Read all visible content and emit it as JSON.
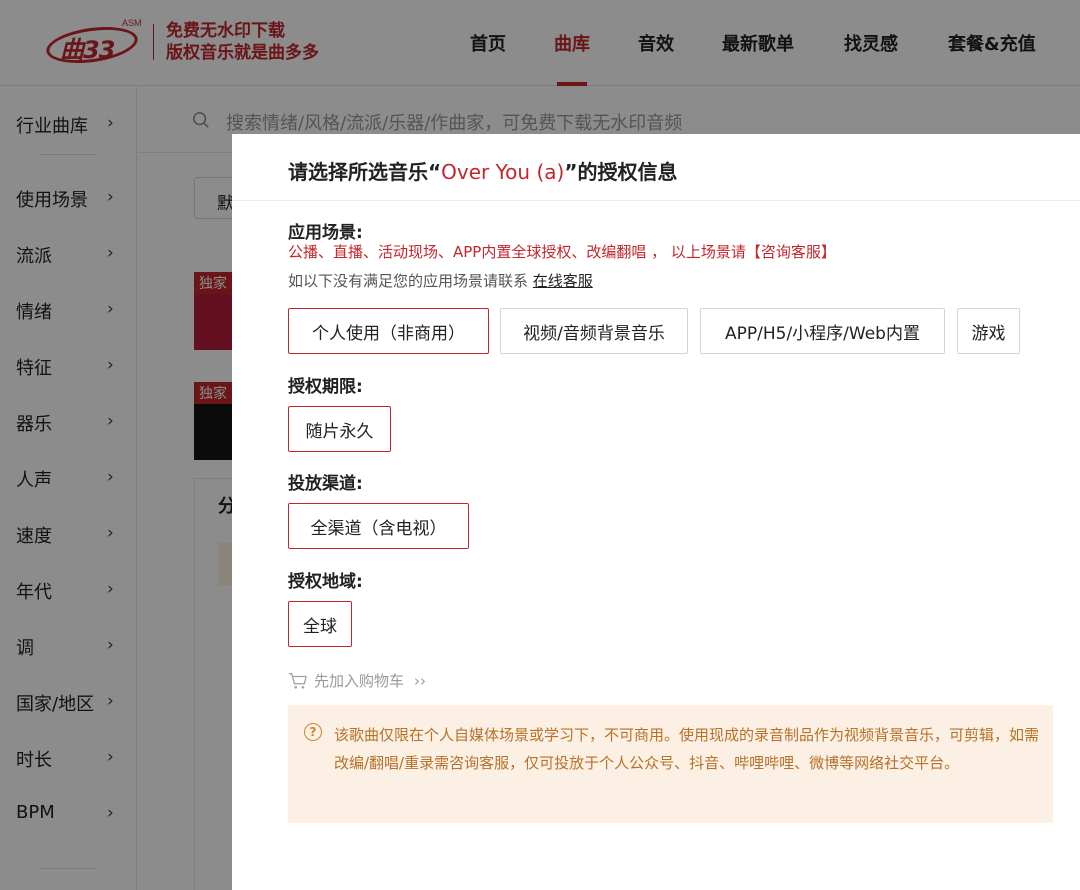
{
  "header": {
    "logo_text": "曲33",
    "logo_sup": "ASM",
    "slogan_line1": "免费无水印下载",
    "slogan_line2": "版权音乐就是曲多多",
    "nav": [
      {
        "label": "首页"
      },
      {
        "label": "曲库"
      },
      {
        "label": "音效"
      },
      {
        "label": "最新歌单"
      },
      {
        "label": "找灵感"
      },
      {
        "label": "套餐&充值"
      }
    ],
    "active_nav": "曲库"
  },
  "sidebar": {
    "items": [
      {
        "label": "行业曲库"
      },
      {
        "label": "使用场景"
      },
      {
        "label": "流派"
      },
      {
        "label": "情绪"
      },
      {
        "label": "特征"
      },
      {
        "label": "器乐"
      },
      {
        "label": "人声"
      },
      {
        "label": "速度"
      },
      {
        "label": "年代"
      },
      {
        "label": "调"
      },
      {
        "label": "国家/地区"
      },
      {
        "label": "时长"
      },
      {
        "label": "BPM"
      }
    ],
    "chevron": "›"
  },
  "search": {
    "placeholder": "搜索情绪/风格/流派/乐器/作曲家，可免费下载无水印音频"
  },
  "background": {
    "sort_button_fragment": "默",
    "tag_exclusive": "独家",
    "panel_tab_fragment": "分"
  },
  "modal": {
    "title_prefix": "请选择所选音乐“",
    "song_name": "Over You (a)",
    "title_suffix": "”的授权信息",
    "scene_label": "应用场景:",
    "scene_note_red": "公播、直播、活动现场、APP内置全球授权、改编翻唱 ， 以上场景请【咨询客服】",
    "scene_note_gray": "如以下没有满足您的应用场景请联系",
    "online_service_link": "在线客服",
    "scene_options": [
      {
        "label": "个人使用（非商用）",
        "selected": true
      },
      {
        "label": "视频/音频背景音乐",
        "selected": false
      },
      {
        "label": "APP/H5/小程序/Web内置",
        "selected": false
      },
      {
        "label": "游戏",
        "selected": false
      }
    ],
    "period_label": "授权期限:",
    "period_options": [
      {
        "label": "随片永久",
        "selected": true
      }
    ],
    "channel_label": "投放渠道:",
    "channel_options": [
      {
        "label": "全渠道（含电视）",
        "selected": true
      }
    ],
    "region_label": "授权地域:",
    "region_options": [
      {
        "label": "全球",
        "selected": true
      }
    ],
    "add_to_cart": "先加入购物车",
    "add_to_cart_arrow": "››",
    "notice_icon": "?",
    "notice_text": "该歌曲仅限在个人自媒体场景或学习下，不可商用。使用现成的录音制品作为视频背景音乐，可剪辑，如需改编/翻唱/重录需咨询客服，仅可投放于个人公众号、抖音、哔哩哔哩、微博等网络社交平台。"
  },
  "colors": {
    "brand_red": "#c1272d",
    "notice_bg": "#fcefe3",
    "notice_text": "#b5732a",
    "overlay": "rgba(0,0,0,0.45)"
  }
}
